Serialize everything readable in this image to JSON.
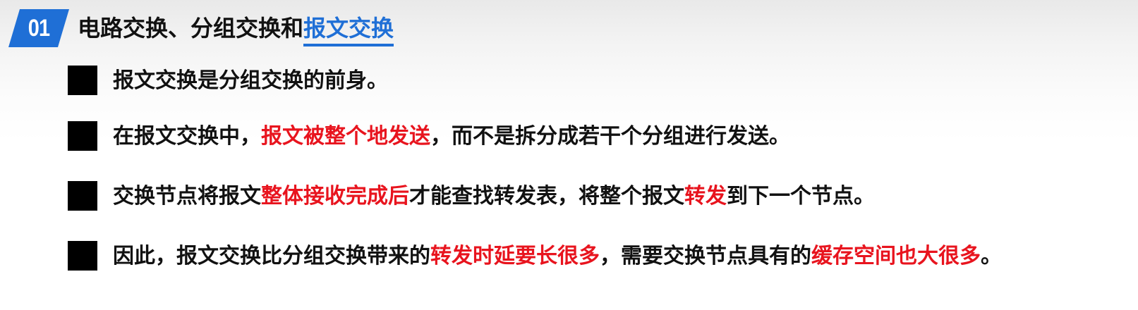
{
  "section": {
    "number": "01",
    "title_plain": "电路交换、分组交换和",
    "title_highlight": "报文交换",
    "accent_color": "#1f6fd6"
  },
  "highlight_color": "#e8141e",
  "bullets": [
    {
      "parts": [
        {
          "text": "报文交换是分组交换的前身。",
          "red": false
        }
      ]
    },
    {
      "parts": [
        {
          "text": "在报文交换中，",
          "red": false
        },
        {
          "text": "报文被整个地发送",
          "red": true
        },
        {
          "text": "，而不是拆分成若干个分组进行发送。",
          "red": false
        }
      ]
    },
    {
      "parts": [
        {
          "text": "交换节点将报文",
          "red": false
        },
        {
          "text": "整体接收完成后",
          "red": true
        },
        {
          "text": "才能查找转发表，将整个报文",
          "red": false
        },
        {
          "text": "转发",
          "red": true
        },
        {
          "text": "到下一个节点。",
          "red": false
        }
      ]
    },
    {
      "parts": [
        {
          "text": "因此，报文交换比分组交换带来的",
          "red": false
        },
        {
          "text": "转发时延要长很多",
          "red": true
        },
        {
          "text": "，需要交换节点具有的",
          "red": false
        },
        {
          "text": "缓存空间也大很多",
          "red": true
        },
        {
          "text": "。",
          "red": false
        }
      ]
    }
  ]
}
